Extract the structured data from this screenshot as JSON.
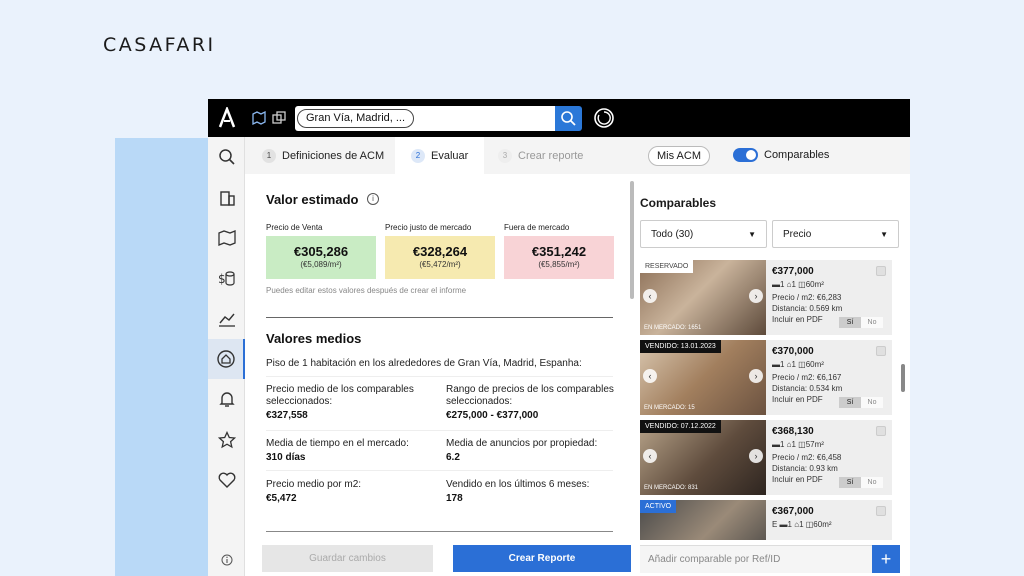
{
  "brand": "CASAFARI",
  "topbar": {
    "search_pill": "Gran Vía, Madrid, ..."
  },
  "tabs": [
    {
      "num": "1",
      "label": "Definiciones de ACM"
    },
    {
      "num": "2",
      "label": "Evaluar"
    },
    {
      "num": "3",
      "label": "Crear reporte"
    }
  ],
  "mis_acm": "Mis ACM",
  "comparables_toggle": "Comparables",
  "valor": {
    "title": "Valor estimado",
    "info": "i",
    "venta_label": "Precio de Venta",
    "venta_value": "€305,286",
    "venta_m2": "(€5,089/m²)",
    "justo_label": "Precio justo de mercado",
    "justo_value": "€328,264",
    "justo_m2": "(€5,472/m²)",
    "fuera_label": "Fuera de mercado",
    "fuera_value": "€351,242",
    "fuera_m2": "(€5,855/m²)",
    "note": "Puedes editar estos valores después de crear el informe"
  },
  "medios": {
    "title": "Valores medios",
    "subtitle": "Piso de 1 habitación en los alrededores de Gran Vía, Madrid, Espanha:",
    "s1_label": "Precio medio de los comparables seleccionados:",
    "s1_value": "€327,558",
    "s2_label": "Rango de precios de los comparables seleccionados:",
    "s2_value": "€275,000 - €377,000",
    "s3_label": "Media de tiempo en el mercado:",
    "s3_value": "310 días",
    "s4_label": "Media de anuncios por propiedad:",
    "s4_value": "6.2",
    "s5_label": "Precio medio por m2:",
    "s5_value": "€5,472",
    "s6_label": "Vendido en los últimos 6 meses:",
    "s6_value": "178"
  },
  "buttons": {
    "save": "Guardar cambios",
    "create": "Crear Reporte"
  },
  "comparables": {
    "title": "Comparables",
    "filter1": "Todo (30)",
    "filter2": "Precio",
    "add_placeholder": "Añadir comparable por Ref/ID",
    "add_btn": "+",
    "cards": [
      {
        "tag": "RESERVADO",
        "market": "EN MERCADO: 1651",
        "price": "€377,000",
        "features": "▬1 ⌂1 ◫60m²",
        "ppm2": "Precio / m2: €6,283",
        "dist": "Distancia: 0.569 km",
        "pdf": "Incluir en PDF",
        "si": "Sí",
        "no": "No"
      },
      {
        "tag": "VENDIDO: 13.01.2023",
        "market": "EN MERCADO: 15",
        "price": "€370,000",
        "features": "▬1 ⌂1 ◫60m²",
        "ppm2": "Precio / m2: €6,167",
        "dist": "Distancia: 0.534 km",
        "pdf": "Incluir en PDF",
        "si": "Sí",
        "no": "No"
      },
      {
        "tag": "VENDIDO: 07.12.2022",
        "market": "EN MERCADO: 831",
        "price": "€368,130",
        "features": "▬1 ⌂1 ◫57m²",
        "ppm2": "Precio / m2: €6,458",
        "dist": "Distancia: 0.93 km",
        "pdf": "Incluir en PDF",
        "si": "Sí",
        "no": "No"
      },
      {
        "tag": "ACTIVO",
        "market": "",
        "price": "€367,000",
        "features": "E ▬1 ⌂1 ◫60m²",
        "ppm2": "",
        "dist": "",
        "pdf": "",
        "si": "",
        "no": ""
      }
    ]
  },
  "colors": {
    "accent": "#2b6fd6",
    "green": "#c9ecc4",
    "yellow": "#f6eab0",
    "red": "#f8d3d6"
  }
}
